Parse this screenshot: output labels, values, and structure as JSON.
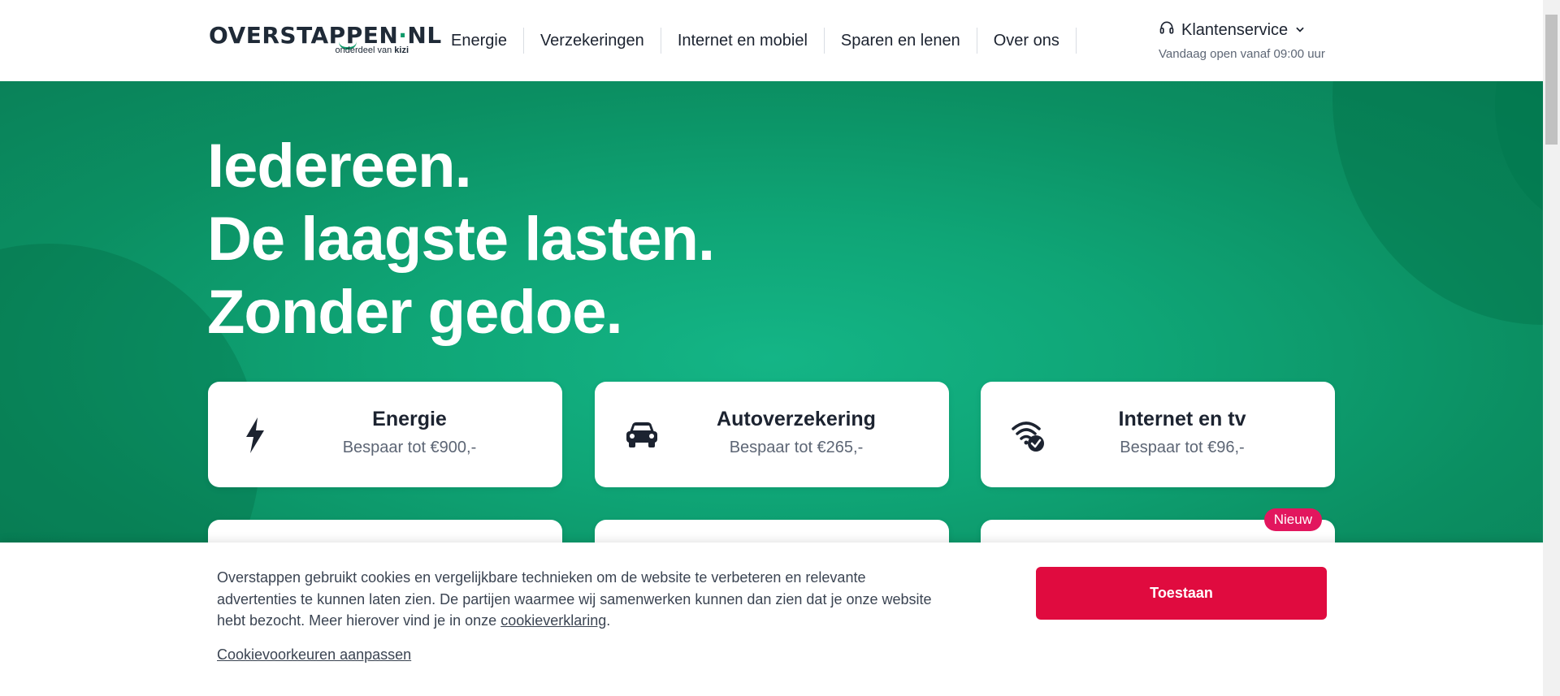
{
  "logo": {
    "text_main": "OVERSTAPPEN",
    "text_dot": "·",
    "text_tld": "NL",
    "subtitle_prefix": "onderdeel van ",
    "subtitle_brand": "kizi"
  },
  "nav": {
    "items": [
      {
        "label": "Energie"
      },
      {
        "label": "Verzekeringen"
      },
      {
        "label": "Internet en mobiel"
      },
      {
        "label": "Sparen en lenen"
      },
      {
        "label": "Over ons"
      }
    ]
  },
  "service": {
    "label": "Klantenservice",
    "hours": "Vandaag open vanaf 09:00 uur",
    "icon": "headset-icon"
  },
  "hero": {
    "lines": [
      "Iedereen.",
      "De laagste lasten.",
      "Zonder gedoe."
    ]
  },
  "cards": [
    {
      "title": "Energie",
      "subtitle": "Bespaar tot €900,-",
      "icon": "lightning-icon"
    },
    {
      "title": "Autoverzekering",
      "subtitle": "Bespaar tot €265,-",
      "icon": "car-icon"
    },
    {
      "title": "Internet en tv",
      "subtitle": "Bespaar tot €96,-",
      "icon": "wifi-check-icon"
    }
  ],
  "badge": {
    "label": "Nieuw"
  },
  "cookie": {
    "text_before_link": "Overstappen gebruikt cookies en vergelijkbare technieken om de website te verbeteren en relevante advertenties te kunnen laten zien. De partijen waarmee wij samenwerken kunnen dan zien dat je onze website hebt bezocht. Meer hierover vind je in onze ",
    "link_label": "cookieverklaring",
    "text_after_link": ".",
    "preferences_label": "Cookievoorkeuren aanpassen",
    "accept_label": "Toestaan"
  },
  "colors": {
    "brand_green": "#0f9a6a",
    "accept_red": "#e00b3f",
    "badge_pink": "#e2165e"
  }
}
